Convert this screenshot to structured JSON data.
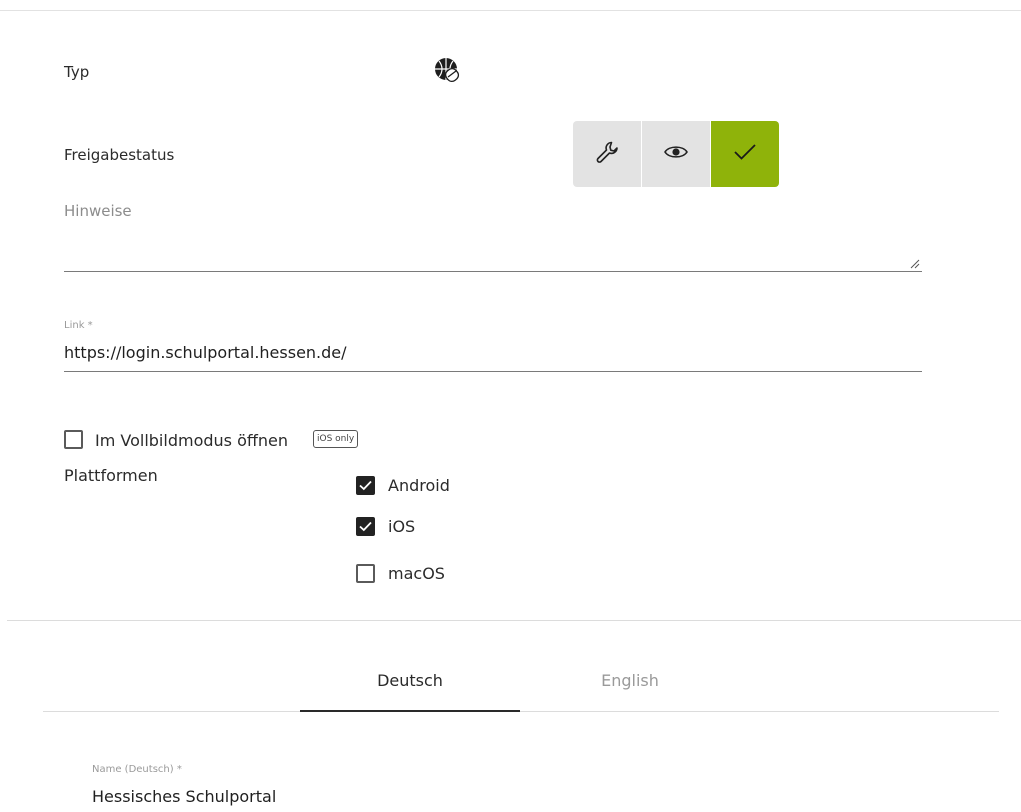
{
  "type": {
    "label": "Typ",
    "icon": "globe-link-icon"
  },
  "release_status": {
    "label": "Freigabestatus",
    "options": [
      {
        "icon": "wrench-icon",
        "active": false
      },
      {
        "icon": "eye-icon",
        "active": false
      },
      {
        "icon": "checkmark-icon",
        "active": true
      }
    ],
    "active_color": "#8fb30a"
  },
  "notes": {
    "label": "Hinweise",
    "value": ""
  },
  "link": {
    "label": "Link *",
    "value": "https://login.schulportal.hessen.de/"
  },
  "fullscreen": {
    "label": "Im Vollbildmodus öffnen",
    "checked": false,
    "badge": "iOS only"
  },
  "platforms": {
    "label": "Plattformen",
    "items": [
      {
        "label": "Android",
        "checked": true
      },
      {
        "label": "iOS",
        "checked": true
      },
      {
        "label": "macOS",
        "checked": false
      }
    ]
  },
  "language_tabs": [
    {
      "label": "Deutsch",
      "active": true
    },
    {
      "label": "English",
      "active": false
    }
  ],
  "name_de": {
    "label": "Name (Deutsch) *",
    "value": "Hessisches Schulportal"
  }
}
